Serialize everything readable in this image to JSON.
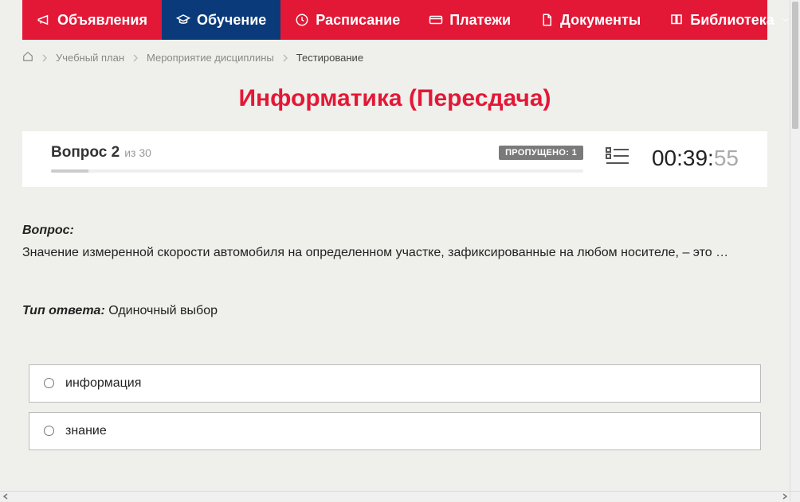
{
  "nav": {
    "items": [
      {
        "label": "Объявления",
        "icon": "megaphone"
      },
      {
        "label": "Обучение",
        "icon": "graduation"
      },
      {
        "label": "Расписание",
        "icon": "clock"
      },
      {
        "label": "Платежи",
        "icon": "card"
      },
      {
        "label": "Документы",
        "icon": "doc"
      },
      {
        "label": "Библиотека",
        "icon": "book"
      }
    ],
    "active_index": 1
  },
  "breadcrumb": {
    "items": [
      {
        "label": "Учебный план"
      },
      {
        "label": "Мероприятие дисциплины"
      }
    ],
    "current": "Тестирование"
  },
  "page_title": "Информатика (Пересдача)",
  "status": {
    "question_prefix": "Вопрос",
    "question_num": "2",
    "of_prefix": "из",
    "total": "30",
    "skipped_label": "ПРОПУЩЕНО:",
    "skipped_count": "1"
  },
  "timer": {
    "main": "00:39:",
    "sec": "55"
  },
  "question": {
    "label": "Вопрос:",
    "text": "Значение измеренной скорости автомобиля на определенном участке, зафиксированные на любом носителе, – это …"
  },
  "answer_type": {
    "label": "Тип ответа:",
    "value": "Одиночный выбор"
  },
  "options": [
    {
      "text": "информация"
    },
    {
      "text": "знание"
    }
  ]
}
